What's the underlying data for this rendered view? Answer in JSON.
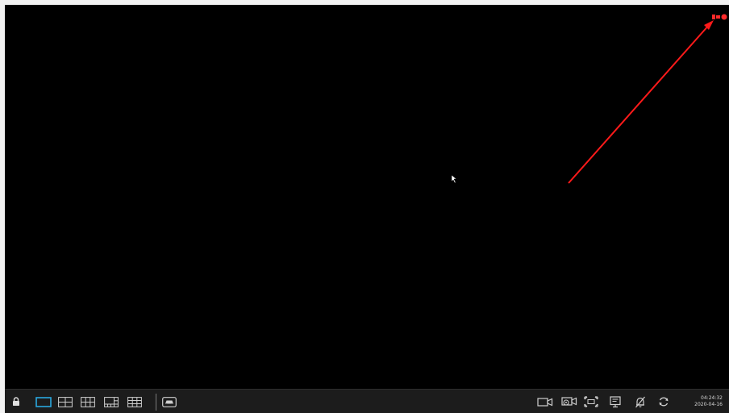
{
  "screen": {
    "background": "#000000"
  },
  "recording_indicator": {
    "icon": "recording-indicator-icon",
    "color": "#ff2a2a"
  },
  "annotation": {
    "type": "arrow",
    "color": "#ff1a1a"
  },
  "taskbar": {
    "background": "#1c1c1c",
    "accent_color": "#2aa8e0",
    "left_buttons": [
      {
        "name": "lock-button",
        "icon": "lock-icon"
      },
      {
        "name": "layout-1-button",
        "icon": "single-view-icon",
        "selected": true
      },
      {
        "name": "layout-4-button",
        "icon": "quad-view-icon"
      },
      {
        "name": "layout-6-button",
        "icon": "six-view-icon"
      },
      {
        "name": "layout-8-button",
        "icon": "eight-view-icon"
      },
      {
        "name": "layout-9-button",
        "icon": "nine-view-icon"
      },
      {
        "name": "sequence-button",
        "icon": "sequence-icon"
      }
    ],
    "right_buttons": [
      {
        "name": "record-button",
        "icon": "camera-icon"
      },
      {
        "name": "camera-settings-button",
        "icon": "camera-gear-icon"
      },
      {
        "name": "fullscreen-button",
        "icon": "fullscreen-icon"
      },
      {
        "name": "display-button",
        "icon": "monitor-icon"
      },
      {
        "name": "mute-button",
        "icon": "muted-bell-icon"
      },
      {
        "name": "refresh-button",
        "icon": "refresh-icon"
      }
    ],
    "clock": {
      "time": "04:24:32",
      "date": "2020-04-16"
    }
  }
}
